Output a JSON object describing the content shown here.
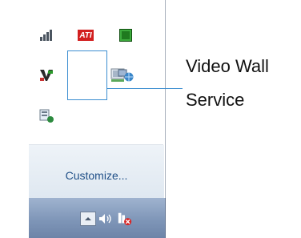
{
  "flyout": {
    "icons": [
      {
        "name": "signal-icon",
        "color": "#5a6470"
      },
      {
        "name": "ati-icon",
        "label": "ATI",
        "color": "#d21f1f"
      },
      {
        "name": "green-square-icon",
        "color": "#2a8a2a"
      },
      {
        "name": "v-logo-icon",
        "color": "#333333"
      },
      {
        "name": "monitor-icon",
        "color": "#9aa6b3"
      },
      {
        "name": "network-globe-icon",
        "color": "#3a86c8"
      },
      {
        "name": "gadget-icon",
        "color": "#3a86c8"
      }
    ],
    "customize_label": "Customize..."
  },
  "taskbar": {
    "buttons": [
      {
        "name": "show-hidden-icons-arrow-icon"
      },
      {
        "name": "volume-icon"
      },
      {
        "name": "network-error-icon"
      }
    ]
  },
  "callout": {
    "line1": "Video Wall",
    "line2": "Service",
    "accent": "#3c8ed0"
  }
}
